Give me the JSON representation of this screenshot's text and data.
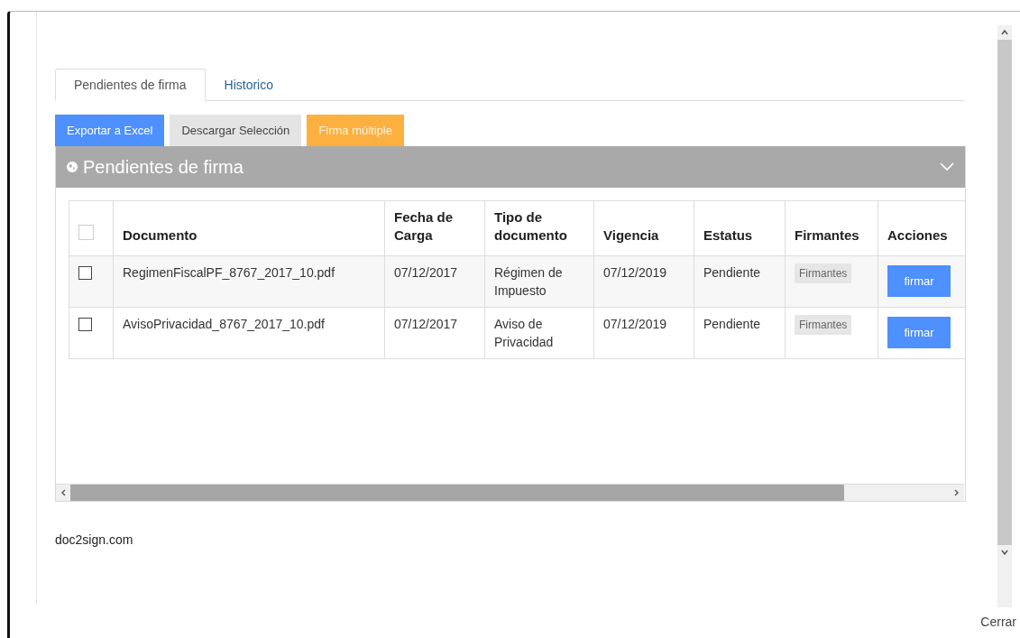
{
  "tabs": [
    {
      "label": "Pendientes de firma",
      "selected": true
    },
    {
      "label": "Historico",
      "selected": false
    }
  ],
  "toolbar": [
    {
      "label": "Exportar a Excel",
      "kind": "primary"
    },
    {
      "label": "Descargar Selección",
      "kind": "default"
    },
    {
      "label": "Firma múltiple",
      "kind": "warning"
    }
  ],
  "panel": {
    "title": "Pendientes de firma"
  },
  "table": {
    "select_all": {
      "checked": false
    },
    "columns": [
      "Documento",
      "Fecha de Carga",
      "Tipo de documento",
      "Vigencia",
      "Estatus",
      "Firmantes",
      "Acciones"
    ],
    "rows": [
      {
        "checked": false,
        "document": "RegimenFiscalPF_8767_2017_10.pdf",
        "upload_date": "07/12/2017",
        "doc_type": "Régimen de Impuesto",
        "validity": "07/12/2019",
        "status": "Pendiente",
        "signers": "Firmantes",
        "action": "firmar"
      },
      {
        "checked": false,
        "document": "AvisoPrivacidad_8767_2017_10.pdf",
        "upload_date": "07/12/2017",
        "doc_type": "Aviso de Privacidad",
        "validity": "07/12/2019",
        "status": "Pendiente",
        "signers": "Firmantes",
        "action": "firmar"
      }
    ]
  },
  "footer": "doc2sign.com",
  "close_link": "Cerrar"
}
